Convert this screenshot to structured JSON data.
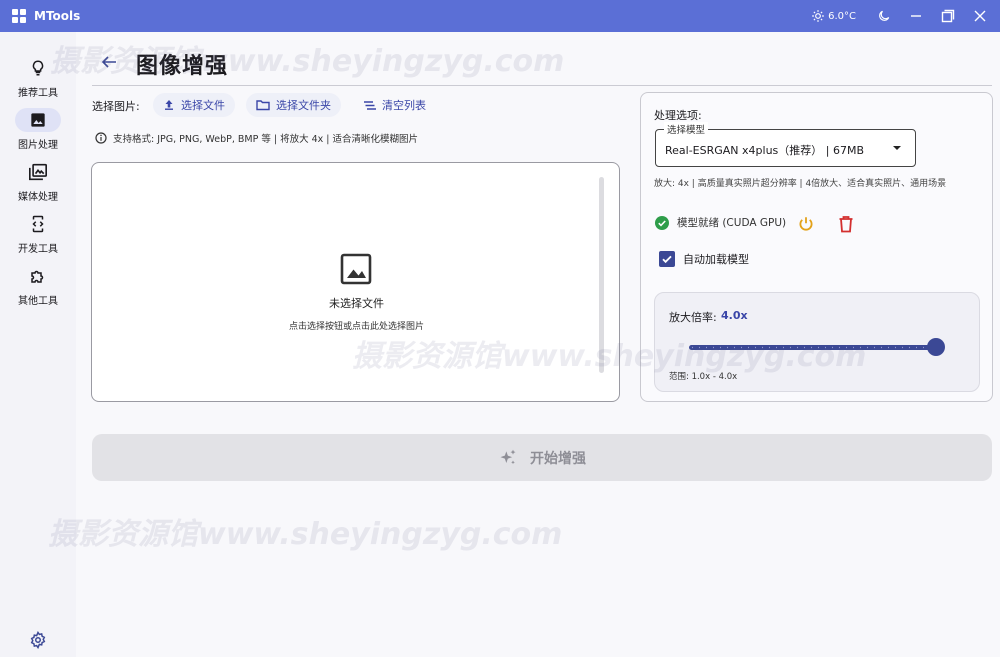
{
  "app": {
    "title": "MTools"
  },
  "titlebar": {
    "weather": "6.0°C"
  },
  "sidebar": {
    "items": [
      {
        "label": "推荐工具",
        "icon": "lightbulb-icon"
      },
      {
        "label": "图片处理",
        "icon": "image-icon"
      },
      {
        "label": "媒体处理",
        "icon": "media-library-icon"
      },
      {
        "label": "开发工具",
        "icon": "developer-mode-icon"
      },
      {
        "label": "其他工具",
        "icon": "extension-puzzle-icon"
      }
    ],
    "active_index": 1
  },
  "page": {
    "title": "图像增强",
    "select_label": "选择图片:",
    "select_file": "选择文件",
    "select_folder": "选择文件夹",
    "clear_list": "清空列表",
    "formats_info": "支持格式: JPG, PNG, WebP, BMP 等 | 将放大 4x | 适合清晰化模糊图片"
  },
  "dropzone": {
    "title": "未选择文件",
    "subtitle": "点击选择按钮或点击此处选择图片"
  },
  "options": {
    "title": "处理选项:",
    "model_legend": "选择模型",
    "model_value": "Real-ESRGAN x4plus（推荐）  |  67MB",
    "model_desc": "放大: 4x | 高质量真实照片超分辨率 | 4倍放大、适合真实照片、通用场景",
    "status_text": "模型就绪 (CUDA GPU)",
    "auto_load_label": "自动加载模型",
    "auto_load_checked": true,
    "scale_label": "放大倍率:",
    "scale_value": "4.0x",
    "scale_fraction": 1.0,
    "range_text": "范围: 1.0x - 4.0x"
  },
  "action": {
    "start_label": "开始增强"
  },
  "watermark": "摄影资源馆www.sheyingzyg.com",
  "colors": {
    "titlebar": "#5b6fd6",
    "primary": "#3b4895",
    "success": "#2e9d4a",
    "warning": "#e3a21a",
    "danger": "#d32f2f"
  }
}
